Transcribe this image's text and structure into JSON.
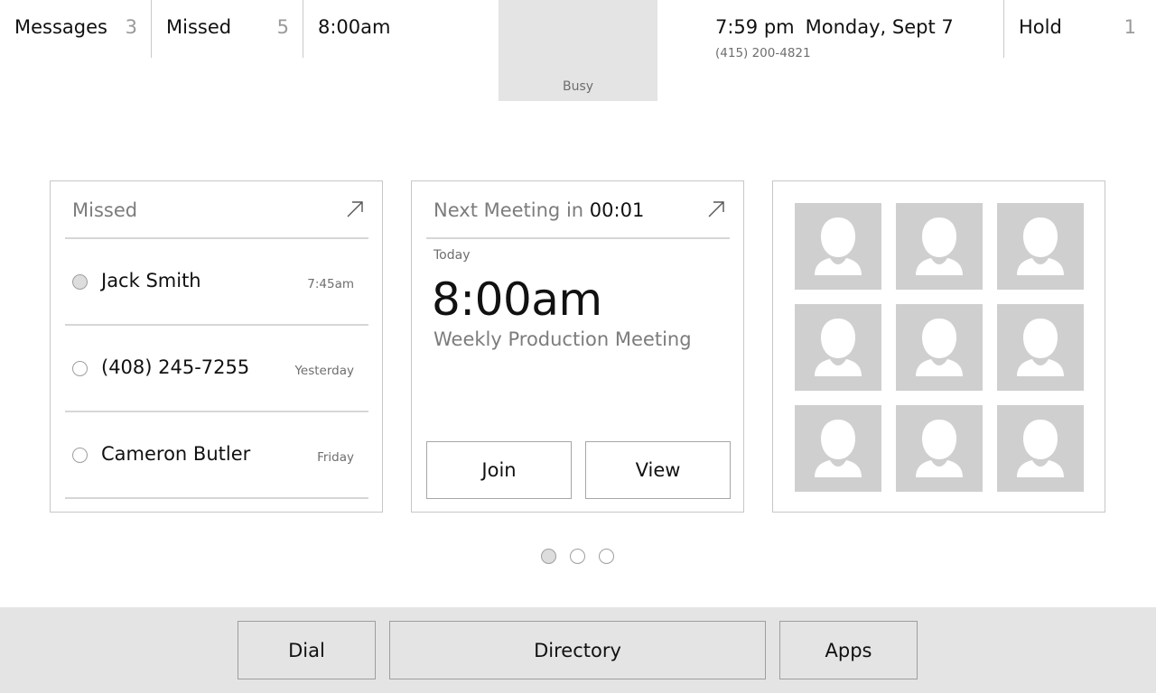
{
  "topbar": {
    "messages": {
      "label": "Messages",
      "count": "3"
    },
    "missed": {
      "label": "Missed",
      "count": "5"
    },
    "next_time": "8:00am",
    "status": "Busy",
    "clock": {
      "time": "7:59 pm",
      "date": "Monday, Sept 7"
    },
    "phone_number": "(415) 200-4821",
    "hold": {
      "label": "Hold",
      "count": "1"
    }
  },
  "missed_card": {
    "title": "Missed",
    "expand_icon": "expand-arrow-icon",
    "items": [
      {
        "name": "Jack Smith",
        "time": "7:45am",
        "selected": true
      },
      {
        "name": "(408) 245-7255",
        "time": "Yesterday",
        "selected": false
      },
      {
        "name": "Cameron Butler",
        "time": "Friday",
        "selected": false
      }
    ]
  },
  "meeting_card": {
    "title_prefix": "Next Meeting in",
    "countdown": "00:01",
    "expand_icon": "expand-arrow-icon",
    "day": "Today",
    "time": "8:00am",
    "name": "Weekly Production Meeting",
    "join_label": "Join",
    "view_label": "View"
  },
  "favorites_card": {
    "avatar_icon": "person-placeholder-icon",
    "avatar_count": 9
  },
  "pagination": {
    "pages": 3,
    "current": 1
  },
  "bottom": {
    "dial_label": "Dial",
    "directory_label": "Directory",
    "apps_label": "Apps"
  },
  "colors": {
    "panel_gray": "#e4e4e4",
    "placeholder_gray": "#cfcfcf",
    "muted_text": "#7c7c7c",
    "divider": "#d6d6d6"
  }
}
